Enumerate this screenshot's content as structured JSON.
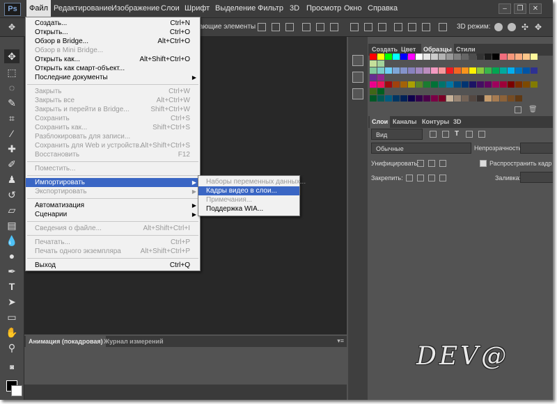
{
  "app": {
    "logo": "Ps"
  },
  "menubar": {
    "items": [
      "Файл",
      "Редактирование",
      "Изображение",
      "Слои",
      "Шрифт",
      "Выделение",
      "Фильтр",
      "3D",
      "Просмотр",
      "Окно",
      "Справка"
    ],
    "active": "Файл"
  },
  "window_controls": {
    "minimize": "–",
    "restore": "❐",
    "close": "✕"
  },
  "options_bar": {
    "text": "ающие элементы",
    "mode_label": "3D режим:"
  },
  "file_menu": {
    "items": [
      {
        "label": "Создать...",
        "shortcut": "Ctrl+N",
        "enabled": true
      },
      {
        "label": "Открыть...",
        "shortcut": "Ctrl+O",
        "enabled": true
      },
      {
        "label": "Обзор в Bridge...",
        "shortcut": "Alt+Ctrl+O",
        "enabled": true
      },
      {
        "label": "Обзор в Mini Bridge...",
        "shortcut": "",
        "enabled": false
      },
      {
        "label": "Открыть как...",
        "shortcut": "Alt+Shift+Ctrl+O",
        "enabled": true
      },
      {
        "label": "Открыть как смарт-объект...",
        "shortcut": "",
        "enabled": true
      },
      {
        "label": "Последние документы",
        "shortcut": "",
        "enabled": true,
        "submenu": true
      },
      {
        "label": "Закрыть",
        "shortcut": "Ctrl+W",
        "enabled": false
      },
      {
        "label": "Закрыть все",
        "shortcut": "Alt+Ctrl+W",
        "enabled": false
      },
      {
        "label": "Закрыть и перейти в Bridge...",
        "shortcut": "Shift+Ctrl+W",
        "enabled": false
      },
      {
        "label": "Сохранить",
        "shortcut": "Ctrl+S",
        "enabled": false
      },
      {
        "label": "Сохранить как...",
        "shortcut": "Shift+Ctrl+S",
        "enabled": false
      },
      {
        "label": "Разблокировать для записи...",
        "shortcut": "",
        "enabled": false
      },
      {
        "label": "Сохранить для Web и устройств...",
        "shortcut": "Alt+Shift+Ctrl+S",
        "enabled": false
      },
      {
        "label": "Восстановить",
        "shortcut": "F12",
        "enabled": false
      },
      {
        "label": "Поместить...",
        "shortcut": "",
        "enabled": false
      },
      {
        "label": "Импортировать",
        "shortcut": "",
        "enabled": true,
        "submenu": true,
        "highlighted": true
      },
      {
        "label": "Экспортировать",
        "shortcut": "",
        "enabled": false,
        "submenu": true
      },
      {
        "label": "Автоматизация",
        "shortcut": "",
        "enabled": true,
        "submenu": true
      },
      {
        "label": "Сценарии",
        "shortcut": "",
        "enabled": true,
        "submenu": true
      },
      {
        "label": "Сведения о файле...",
        "shortcut": "Alt+Shift+Ctrl+I",
        "enabled": false
      },
      {
        "label": "Печатать...",
        "shortcut": "Ctrl+P",
        "enabled": false
      },
      {
        "label": "Печать одного экземпляра",
        "shortcut": "Alt+Shift+Ctrl+P",
        "enabled": false
      },
      {
        "label": "Выход",
        "shortcut": "Ctrl+Q",
        "enabled": true
      }
    ]
  },
  "import_submenu": {
    "items": [
      {
        "label": "Наборы переменных данных...",
        "enabled": false
      },
      {
        "label": "Кадры видео в слои...",
        "enabled": true,
        "highlighted": true
      },
      {
        "label": "Примечания...",
        "enabled": false
      },
      {
        "label": "Поддержка WIA...",
        "enabled": true
      }
    ]
  },
  "swatches_panel": {
    "tabs": [
      "Создать",
      "Цвет",
      "Образцы",
      "Стили"
    ],
    "active_tab": "Образцы",
    "rows": [
      [
        "#ff0000",
        "#ffff00",
        "#00ff00",
        "#00ffff",
        "#0000ff",
        "#ff00ff",
        "#ffffff",
        "#e6e6e6",
        "#cccccc",
        "#b3b3b3",
        "#999999",
        "#808080",
        "#666666",
        "#4d4d4d",
        "#333333",
        "#1a1a1a",
        "#000000",
        "#f26d7d",
        "#f7977a",
        "#fbad82",
        "#fdc68a",
        "#fff79a",
        "#c4df9b",
        "#a2d39c"
      ],
      [
        "#82ca9d",
        "#7bcdc8",
        "#6ecff6",
        "#7ea7d8",
        "#8493ca",
        "#8882be",
        "#a187be",
        "#bc8dbf",
        "#f49ac2",
        "#f6989d",
        "#ed1c24",
        "#f26522",
        "#f7941d",
        "#fff200",
        "#8dc73f",
        "#39b54a",
        "#00a651",
        "#00a99d",
        "#00aeef",
        "#0072bc",
        "#0054a6",
        "#2e3192",
        "#662d91",
        "#92278f"
      ],
      [
        "#ec008c",
        "#ed145b",
        "#9e0b0f",
        "#a0410d",
        "#a36209",
        "#aba000",
        "#598527",
        "#1a7b30",
        "#007236",
        "#00746b",
        "#0076a3",
        "#004b80",
        "#003471",
        "#1b1464",
        "#440e62",
        "#630460",
        "#9e005d",
        "#9e0039",
        "#790000",
        "#7b2e00",
        "#7d4900",
        "#827b00",
        "#406618",
        "#005e20"
      ],
      [
        "#005826",
        "#005952",
        "#005b7f",
        "#003663",
        "#002157",
        "#0d004c",
        "#32004b",
        "#4b0049",
        "#7b0046",
        "#7a0026",
        "#c7b299",
        "#998675",
        "#736357",
        "#534741",
        "#362f2d",
        "#c69c6d",
        "#a67c52",
        "#8c6239",
        "#754c24",
        "#603913"
      ]
    ]
  },
  "layers_panel": {
    "tabs": [
      "Слои",
      "Каналы",
      "Контуры",
      "3D"
    ],
    "active_tab": "Слои",
    "filter_value": "Вид",
    "blend_mode": "Обычные",
    "opacity_label": "Непрозрачность:",
    "unify_label": "Унифицировать:",
    "propagate_label": "Распространить кадр",
    "lock_label": "Закрепить:",
    "fill_label": "Заливка:"
  },
  "bottom_panel": {
    "tabs": [
      "Анимация (покадровая)",
      "Журнал измерений"
    ],
    "active_tab": "Анимация (покадровая)"
  },
  "watermark": {
    "text": "DEV@"
  }
}
